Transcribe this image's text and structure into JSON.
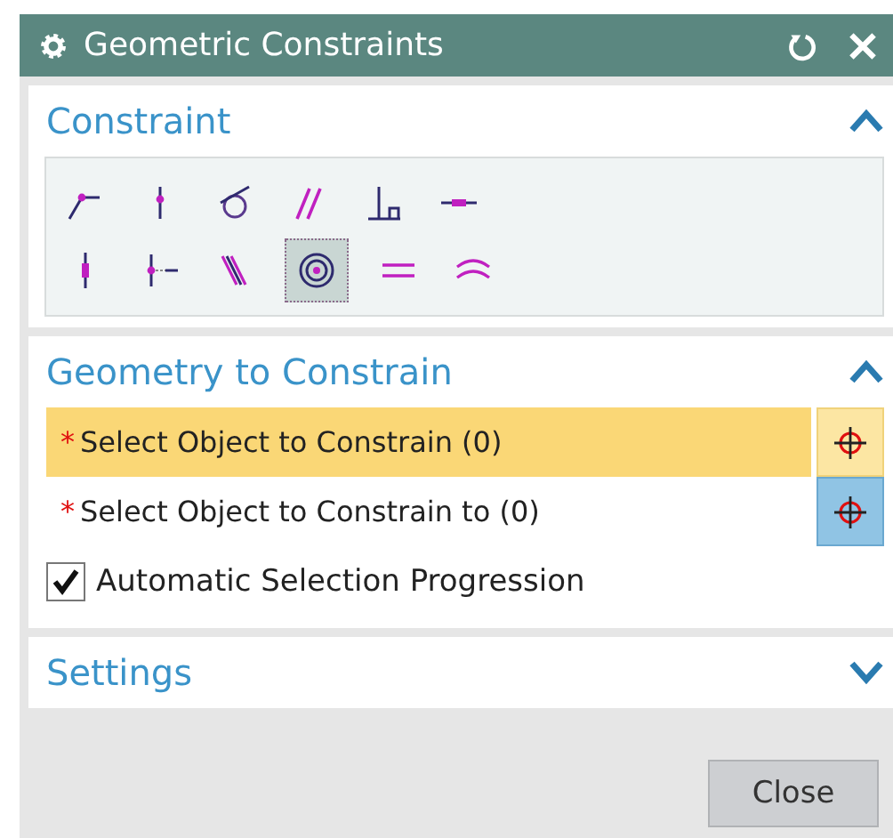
{
  "window": {
    "title": "Geometric Constraints"
  },
  "constraint": {
    "title": "Constraint",
    "expanded": true,
    "icons": [
      {
        "kind": "angle-point",
        "selected": false
      },
      {
        "kind": "point-on-line",
        "selected": false
      },
      {
        "kind": "tangent",
        "selected": false
      },
      {
        "kind": "parallel",
        "selected": false
      },
      {
        "kind": "perpendicular",
        "selected": false
      },
      {
        "kind": "horizontal",
        "selected": false
      },
      {
        "kind": "vertical",
        "selected": false
      },
      {
        "kind": "midpoint",
        "selected": false
      },
      {
        "kind": "collinear",
        "selected": false
      },
      {
        "kind": "concentric",
        "selected": true
      },
      {
        "kind": "equal-length",
        "selected": false
      },
      {
        "kind": "equal-radius",
        "selected": false
      }
    ]
  },
  "geometry": {
    "title": "Geometry to Constrain",
    "expanded": true,
    "selections": [
      {
        "required_mark": "*",
        "label": "Select Object to Constrain (0)",
        "active": true
      },
      {
        "required_mark": "*",
        "label": "Select Object to Constrain to (0)",
        "active": false
      }
    ],
    "auto_progression": {
      "label": "Automatic Selection Progression",
      "checked": true
    }
  },
  "settings": {
    "title": "Settings",
    "expanded": false
  },
  "buttons": {
    "close": "Close"
  }
}
